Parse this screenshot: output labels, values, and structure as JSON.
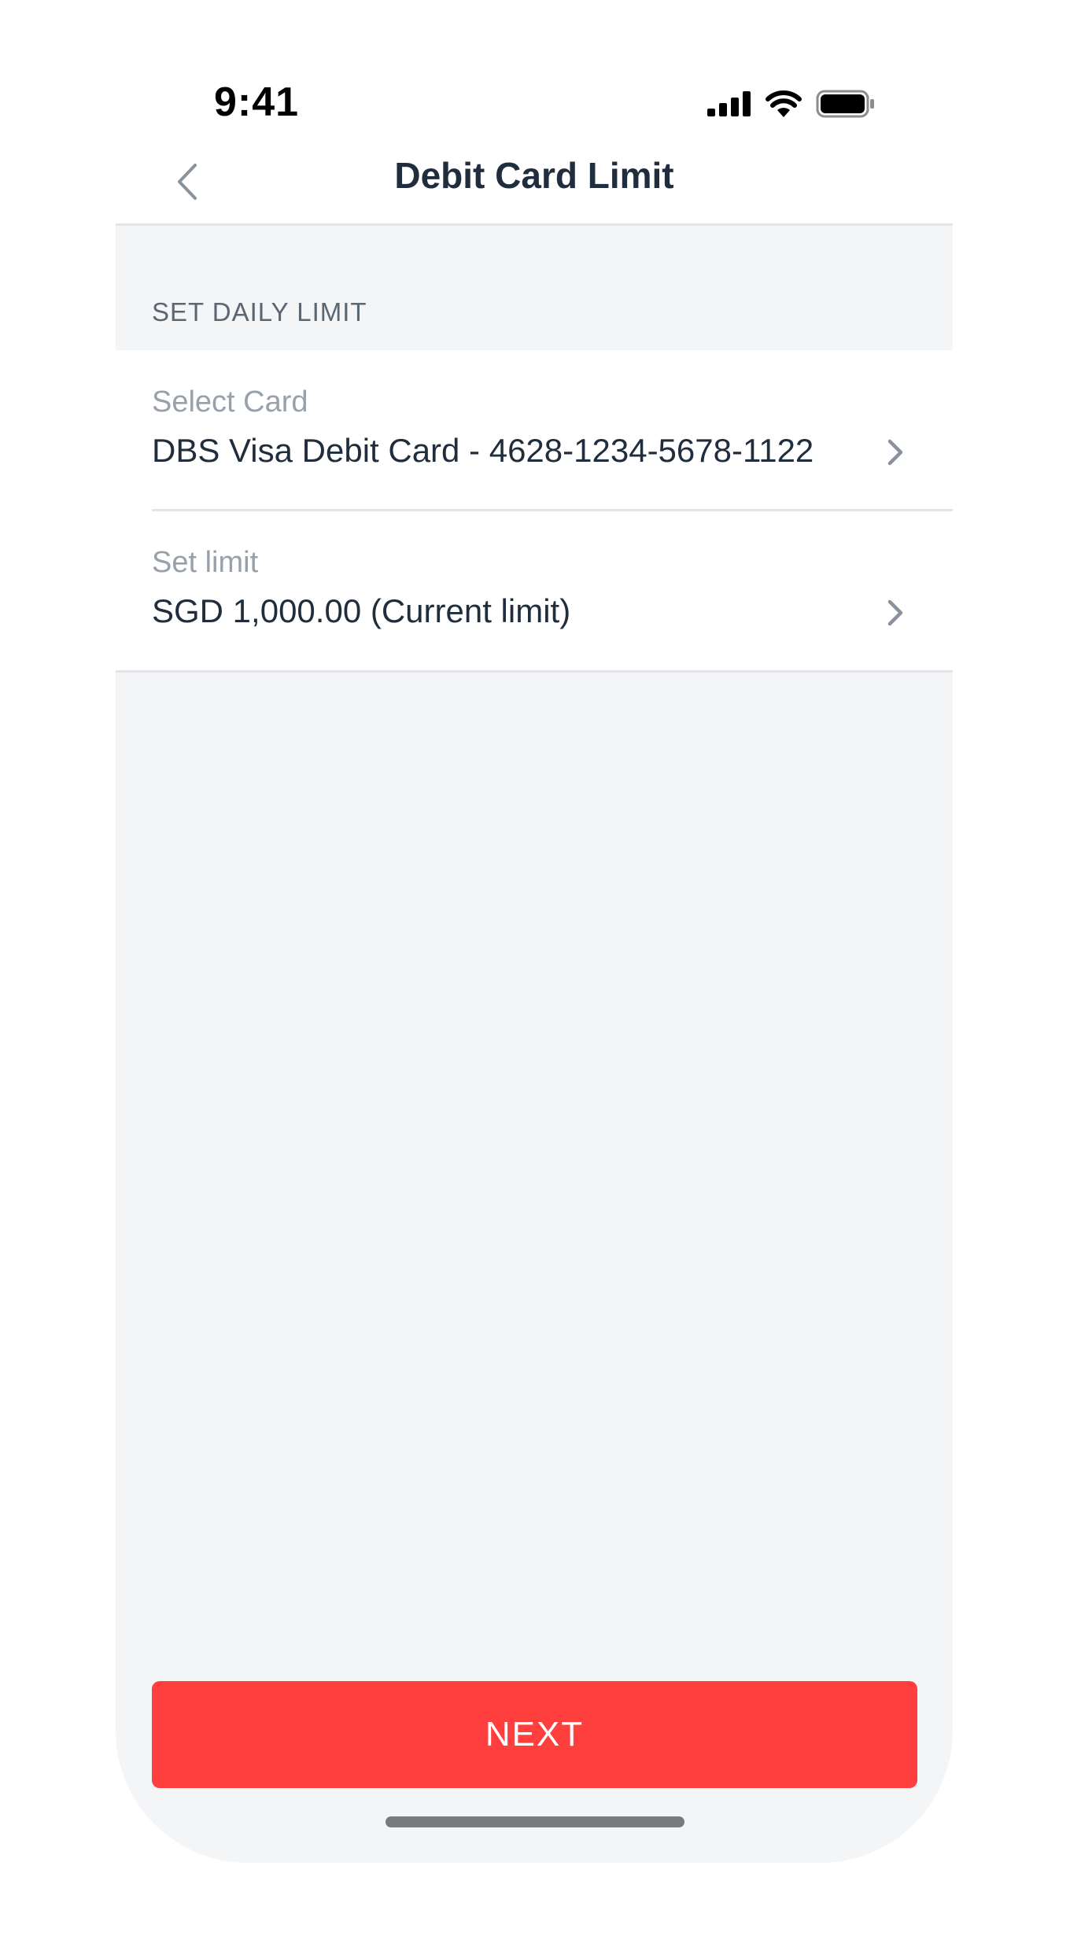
{
  "status_bar": {
    "time": "9:41",
    "icons": [
      "cellular-signal-icon",
      "wifi-icon",
      "battery-icon"
    ]
  },
  "header": {
    "back_icon": "chevron-left-icon",
    "title": "Debit Card Limit"
  },
  "section": {
    "header": "SET DAILY LIMIT"
  },
  "rows": [
    {
      "label": "Select Card",
      "value": "DBS Visa Debit Card - 4628-1234-5678-1122",
      "icon": "chevron-right-icon"
    },
    {
      "label": "Set limit",
      "value": "SGD 1,000.00 (Current limit)",
      "icon": "chevron-right-icon"
    }
  ],
  "footer": {
    "next_label": "NEXT"
  },
  "colors": {
    "accent": "#ff3e3e",
    "background": "#f4f5f7",
    "text_primary": "#1f2d3d",
    "text_secondary": "#98a1ab"
  }
}
